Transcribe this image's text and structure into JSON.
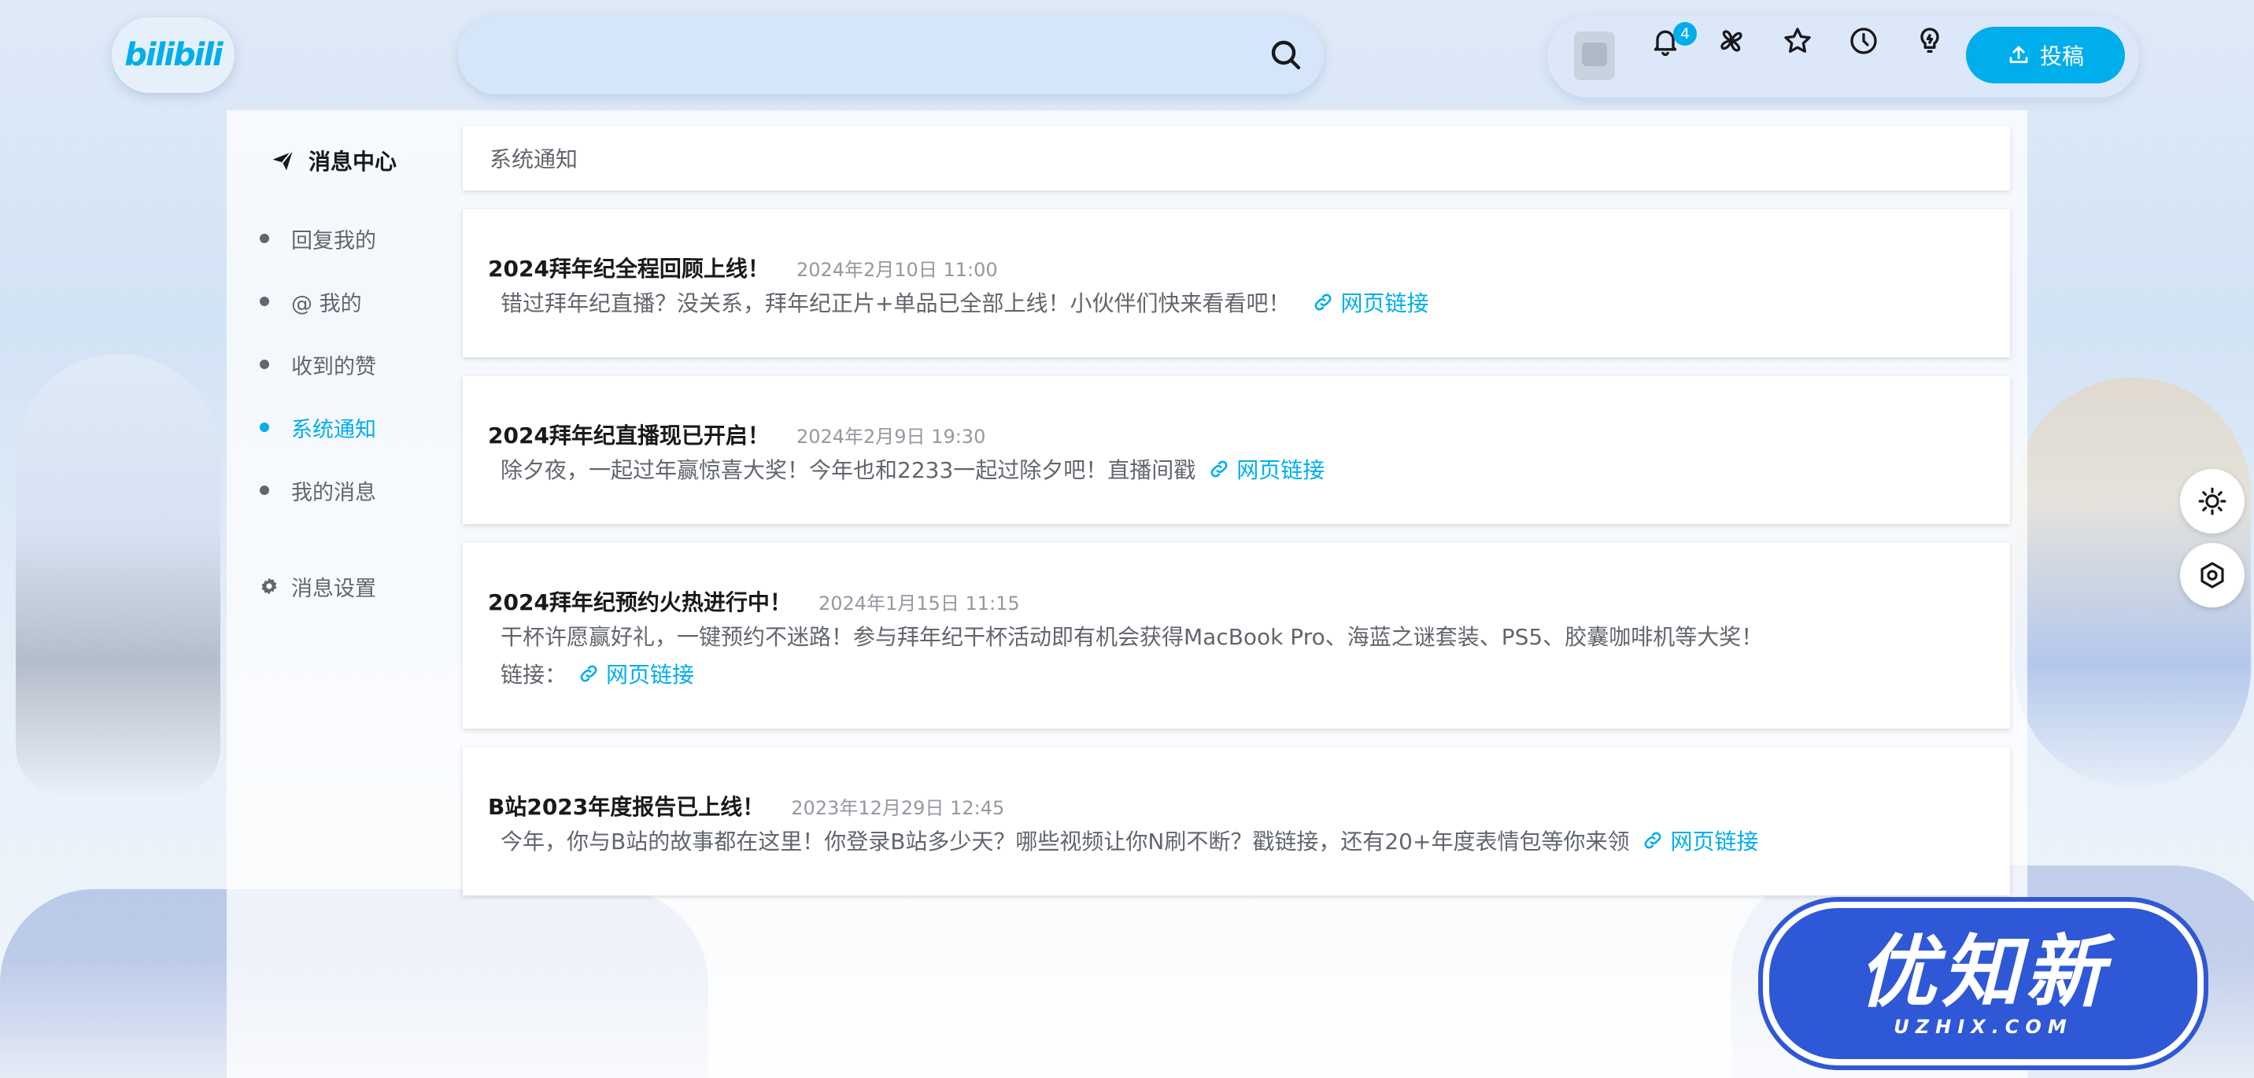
{
  "header": {
    "logo_text": "bilibili",
    "search_placeholder": "",
    "notification_count": "4",
    "upload_label": "投稿"
  },
  "sidebar": {
    "title": "消息中心",
    "items": [
      {
        "label": "回复我的",
        "active": false
      },
      {
        "label": "@ 我的",
        "active": false
      },
      {
        "label": "收到的赞",
        "active": false
      },
      {
        "label": "系统通知",
        "active": true
      },
      {
        "label": "我的消息",
        "active": false
      }
    ],
    "settings_label": "消息设置"
  },
  "main": {
    "section_title": "系统通知",
    "notices": [
      {
        "title": "2024拜年纪全程回顾上线！",
        "time": "2024年2月10日 11:00",
        "body": "错过拜年纪直播？没关系，拜年纪正片+单品已全部上线！小伙伴们快来看看吧！",
        "link_label": "网页链接"
      },
      {
        "title": "2024拜年纪直播现已开启！",
        "time": "2024年2月9日 19:30",
        "body": "除夕夜，一起过年赢惊喜大奖！今年也和2233一起过除夕吧！直播间戳",
        "link_label": "网页链接"
      },
      {
        "title": "2024拜年纪预约火热进行中！",
        "time": "2024年1月15日 11:15",
        "body": "干杯许愿赢好礼，一键预约不迷路！参与拜年纪干杯活动即有机会获得MacBook Pro、海蓝之谜套装、PS5、胶囊咖啡机等大奖！",
        "body2": "链接：",
        "link_label": "网页链接"
      },
      {
        "title": "B站2023年度报告已上线！",
        "time": "2023年12月29日 12:45",
        "body": "今年，你与B站的故事都在这里！你登录B站多少天？哪些视频让你N刷不断？戳链接，还有20+年度表情包等你来领",
        "link_label": "网页链接"
      }
    ]
  },
  "watermark": {
    "big": "优知新",
    "small": "UZHIX.COM"
  },
  "colors": {
    "accent": "#00aeec",
    "text_primary": "#18191c",
    "text_secondary": "#61666d",
    "text_muted": "#9499a0"
  }
}
